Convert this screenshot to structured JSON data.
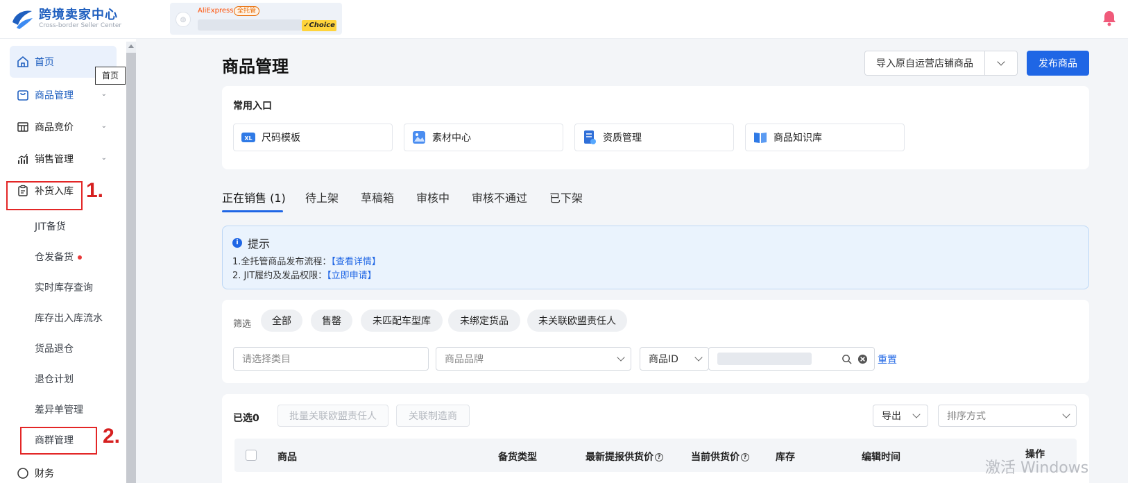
{
  "header": {
    "logo_title": "跨境卖家中心",
    "logo_subtitle": "Cross-border Seller Center",
    "store_platform": "AliExpress",
    "store_tag": "全托管",
    "choice_badge": "✓Choice"
  },
  "sidebar": {
    "tooltip": "首页",
    "items": [
      {
        "label": "首页",
        "icon": "home-icon"
      },
      {
        "label": "商品管理",
        "icon": "product-icon"
      },
      {
        "label": "商品竞价",
        "icon": "bidding-icon"
      },
      {
        "label": "销售管理",
        "icon": "sales-chart-icon"
      },
      {
        "label": "补货入库",
        "icon": "clipboard-icon"
      }
    ],
    "sub_items": [
      "JIT备货",
      "仓发备货",
      "实时库存查询",
      "库存出入库流水",
      "货品退仓",
      "退仓计划",
      "差异单管理",
      "商群管理"
    ],
    "partial_item": "财务",
    "annotations": [
      "1.",
      "2."
    ]
  },
  "main": {
    "title": "商品管理",
    "import_button": "导入原自运营店铺商品",
    "publish_button": "发布商品",
    "common_entry": {
      "title": "常用入口",
      "items": [
        {
          "label": "尺码模板",
          "icon": "size-template-icon"
        },
        {
          "label": "素材中心",
          "icon": "material-icon"
        },
        {
          "label": "资质管理",
          "icon": "certificate-icon"
        },
        {
          "label": "商品知识库",
          "icon": "knowledge-book-icon"
        }
      ]
    },
    "tabs": [
      "正在销售 (1)",
      "待上架",
      "草稿箱",
      "审核中",
      "审核不通过",
      "已下架"
    ],
    "notice": {
      "title": "提示",
      "line1_text": "1.全托管商品发布流程：",
      "line1_link": "【查看详情】",
      "line2_text": "2. JIT履约及发品权限：",
      "line2_link": "【立即申请】"
    },
    "filter": {
      "label": "筛选",
      "chips": [
        "全部",
        "售罄",
        "未匹配车型库",
        "未绑定货品",
        "未关联欧盟责任人"
      ],
      "category_placeholder": "请选择类目",
      "brand_placeholder": "商品品牌",
      "id_select": "商品ID",
      "reset": "重置"
    },
    "list": {
      "selected": "已选0",
      "batch_button": "批量关联欧盟责任人",
      "manufacturer_button": "关联制造商",
      "export_button": "导出",
      "sort_placeholder": "排序方式",
      "columns": [
        "商品",
        "备货类型",
        "最新提报供货价",
        "当前供货价",
        "库存",
        "编辑时间",
        "操作"
      ]
    }
  },
  "watermark": "激活 Windows",
  "colors": {
    "primary": "#1f66e5",
    "annotation_red": "#e32626",
    "brand_blue": "#1f5fbf"
  }
}
